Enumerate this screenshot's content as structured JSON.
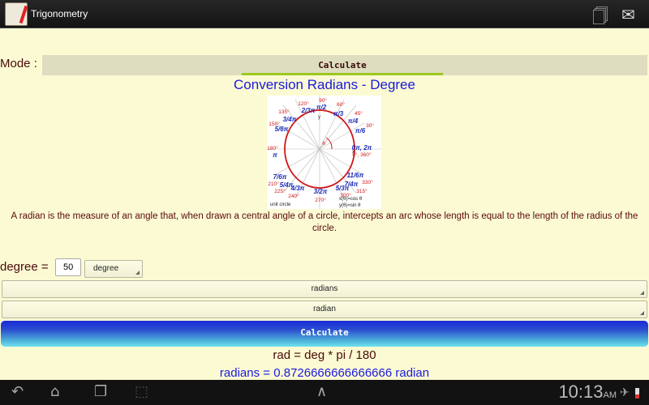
{
  "app": {
    "title": "Trigonometry"
  },
  "mode": {
    "label": "Mode :",
    "tab_label": "Calculate"
  },
  "heading": "Conversion Radians - Degree",
  "unit_circle": {
    "deg_90": "90°",
    "rad_90": "π/2",
    "deg_120": "120°",
    "rad_120": "2/3π",
    "deg_60": "60°",
    "rad_60": "π/3",
    "deg_135": "135°",
    "rad_135": "3/4π",
    "deg_45": "45°",
    "rad_45": "π/4",
    "deg_150": "150°",
    "rad_150": "5/6π",
    "deg_30": "30°",
    "rad_30": "π/6",
    "deg_180": "180°",
    "rad_180": "π",
    "deg_0": "0°, 360°",
    "rad_0": "0π, 2π",
    "deg_210": "210°",
    "rad_210": "7/6π",
    "deg_330": "330°",
    "rad_330": "11/6π",
    "deg_225": "225°",
    "rad_225": "5/4π",
    "deg_315": "315°",
    "rad_315": "7/4π",
    "deg_240": "240°",
    "rad_240": "4/3π",
    "deg_300": "300°",
    "rad_300": "5/3π",
    "deg_270": "270°",
    "rad_270": "3/2π",
    "axis_x": "x",
    "axis_y": "y",
    "theta": "θ",
    "caption": "unit circle",
    "eq_x": "x(θ)=cos θ",
    "eq_y": "y(θ)=sin θ"
  },
  "description": "A radian is the measure of an angle that, when drawn a central angle of a circle, intercepts an arc whose length is equal to the length of the radius of the circle.",
  "form": {
    "degree_label": "degree =",
    "degree_value": "50",
    "unit_select": "degree",
    "target_select": "radians",
    "target_unit_select": "radian",
    "calculate_label": "Calculate"
  },
  "output": {
    "formula": "rad = deg * pi / 180",
    "result": "radians = 0.8726666666666666 radian"
  },
  "status": {
    "time": "10:13",
    "ampm": "AM"
  }
}
